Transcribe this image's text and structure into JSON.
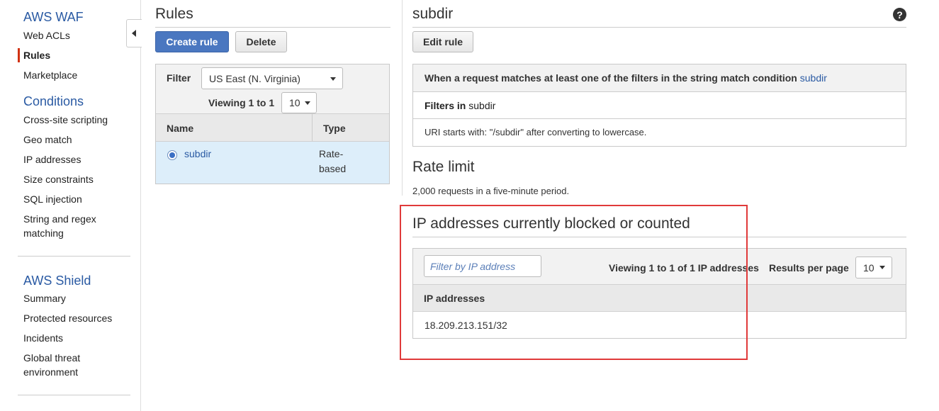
{
  "sidebar": {
    "waf_title": "AWS WAF",
    "waf_items": [
      {
        "label": "Web ACLs"
      },
      {
        "label": "Rules"
      },
      {
        "label": "Marketplace"
      }
    ],
    "conditions_title": "Conditions",
    "condition_items": [
      {
        "label": "Cross-site scripting"
      },
      {
        "label": "Geo match"
      },
      {
        "label": "IP addresses"
      },
      {
        "label": "Size constraints"
      },
      {
        "label": "SQL injection"
      },
      {
        "label": "String and regex"
      },
      {
        "label": "matching"
      }
    ],
    "shield_title": "AWS Shield",
    "shield_items": [
      {
        "label": "Summary"
      },
      {
        "label": "Protected resources"
      },
      {
        "label": "Incidents"
      },
      {
        "label": "Global threat"
      },
      {
        "label": "environment"
      }
    ]
  },
  "rules": {
    "title": "Rules",
    "create_label": "Create rule",
    "delete_label": "Delete",
    "filter_label": "Filter",
    "filter_value": "US East (N. Virginia)",
    "viewing_text": "Viewing 1 to 1",
    "page_size": "10",
    "col_name": "Name",
    "col_type": "Type",
    "row": {
      "name": "subdir",
      "type_line1": "Rate-",
      "type_line2": "based"
    }
  },
  "detail": {
    "title": "subdir",
    "help_glyph": "?",
    "edit_label": "Edit rule",
    "match_prefix": "When a request matches at least one of the filters in the string match condition",
    "match_link": "subdir",
    "filters_bold": "Filters in",
    "filters_name": "subdir",
    "filter_row": "URI starts with: \"/subdir\" after converting to lowercase.",
    "rate_title": "Rate limit",
    "rate_text": "2,000 requests in a five-minute period.",
    "ip_title": "IP addresses currently blocked or counted",
    "ip_filter_placeholder": "Filter by IP address",
    "ip_viewing": "Viewing 1 to 1 of 1 IP addresses",
    "results_label": "Results per page",
    "results_value": "10",
    "ip_col": "IP addresses",
    "ip_rows": [
      "18.209.213.151/32"
    ]
  },
  "colors": {
    "accent": "#4a77c0",
    "active_marker": "#d13212",
    "highlight": "#e03a3a",
    "selected_row": "#ddeefa"
  },
  "icons": {
    "collapse": "caret-left-icon",
    "help": "help-icon",
    "dropdown": "chevron-down-icon",
    "radio": "radio-selected-icon"
  }
}
